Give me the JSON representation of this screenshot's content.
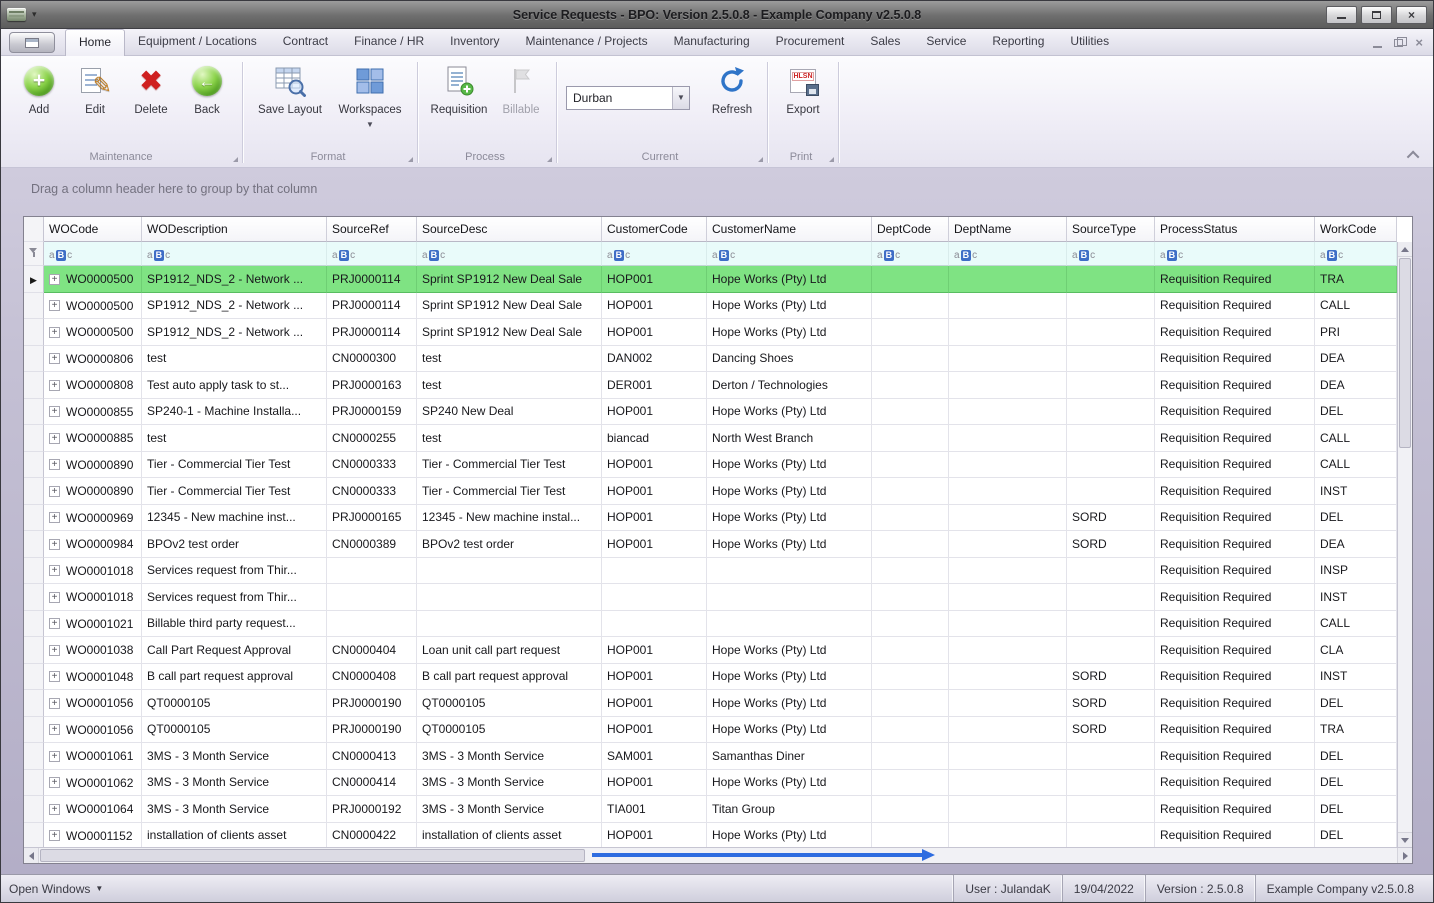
{
  "window": {
    "title": "Service Requests - BPO: Version 2.5.0.8 - Example Company v2.5.0.8"
  },
  "ribbon": {
    "tabs": [
      "Home",
      "Equipment / Locations",
      "Contract",
      "Finance / HR",
      "Inventory",
      "Maintenance / Projects",
      "Manufacturing",
      "Procurement",
      "Sales",
      "Service",
      "Reporting",
      "Utilities"
    ],
    "active_tab": "Home",
    "groups": {
      "maintenance": {
        "label": "Maintenance",
        "add": "Add",
        "edit": "Edit",
        "delete": "Delete",
        "back": "Back"
      },
      "format": {
        "label": "Format",
        "save_layout": "Save Layout",
        "workspaces": "Workspaces"
      },
      "process": {
        "label": "Process",
        "requisition": "Requisition",
        "billable": "Billable"
      },
      "current": {
        "label": "Current",
        "site_value": "Durban",
        "refresh": "Refresh"
      },
      "print": {
        "label": "Print",
        "export": "Export",
        "export_icon_text": "HLSN"
      }
    }
  },
  "grid": {
    "group_hint": "Drag a column header here to group by that column",
    "columns": [
      "WOCode",
      "WODescription",
      "SourceRef",
      "SourceDesc",
      "CustomerCode",
      "CustomerName",
      "DeptCode",
      "DeptName",
      "SourceType",
      "ProcessStatus",
      "WorkCode"
    ],
    "filter_chars": [
      "a",
      "B",
      "c"
    ],
    "selected_row_index": 0,
    "rows": [
      [
        "WO0000500",
        "SP1912_NDS_2 - Network ...",
        "PRJ0000114",
        "Sprint SP1912 New Deal Sale",
        "HOP001",
        "Hope Works (Pty) Ltd",
        "",
        "",
        "",
        "Requisition Required",
        "TRA"
      ],
      [
        "WO0000500",
        "SP1912_NDS_2 - Network ...",
        "PRJ0000114",
        "Sprint SP1912 New Deal Sale",
        "HOP001",
        "Hope Works (Pty) Ltd",
        "",
        "",
        "",
        "Requisition Required",
        "CALL"
      ],
      [
        "WO0000500",
        "SP1912_NDS_2 - Network ...",
        "PRJ0000114",
        "Sprint SP1912 New Deal Sale",
        "HOP001",
        "Hope Works (Pty) Ltd",
        "",
        "",
        "",
        "Requisition Required",
        "PRI"
      ],
      [
        "WO0000806",
        "test",
        "CN0000300",
        "test",
        "DAN002",
        "Dancing Shoes",
        "",
        "",
        "",
        "Requisition Required",
        "DEA"
      ],
      [
        "WO0000808",
        "Test auto apply task to st...",
        "PRJ0000163",
        "test",
        "DER001",
        "Derton / Technologies",
        "",
        "",
        "",
        "Requisition Required",
        "DEA"
      ],
      [
        "WO0000855",
        "SP240-1 - Machine Installa...",
        "PRJ0000159",
        "SP240 New Deal",
        "HOP001",
        "Hope Works (Pty) Ltd",
        "",
        "",
        "",
        "Requisition Required",
        "DEL"
      ],
      [
        "WO0000885",
        "test",
        "CN0000255",
        "test",
        "biancad",
        "North West Branch",
        "",
        "",
        "",
        "Requisition Required",
        "CALL"
      ],
      [
        "WO0000890",
        "Tier - Commercial Tier Test",
        "CN0000333",
        "Tier - Commercial Tier Test",
        "HOP001",
        "Hope Works (Pty) Ltd",
        "",
        "",
        "",
        "Requisition Required",
        "CALL"
      ],
      [
        "WO0000890",
        "Tier - Commercial Tier Test",
        "CN0000333",
        "Tier - Commercial Tier Test",
        "HOP001",
        "Hope Works (Pty) Ltd",
        "",
        "",
        "",
        "Requisition Required",
        "INST"
      ],
      [
        "WO0000969",
        "12345 - New machine inst...",
        "PRJ0000165",
        "12345 - New machine instal...",
        "HOP001",
        "Hope Works (Pty) Ltd",
        "",
        "",
        "SORD",
        "Requisition Required",
        "DEL"
      ],
      [
        "WO0000984",
        "BPOv2 test order",
        "CN0000389",
        "BPOv2 test order",
        "HOP001",
        "Hope Works (Pty) Ltd",
        "",
        "",
        "SORD",
        "Requisition Required",
        "DEA"
      ],
      [
        "WO0001018",
        "Services request from Thir...",
        "",
        "",
        "",
        "",
        "",
        "",
        "",
        "Requisition Required",
        "INSP"
      ],
      [
        "WO0001018",
        "Services request from Thir...",
        "",
        "",
        "",
        "",
        "",
        "",
        "",
        "Requisition Required",
        "INST"
      ],
      [
        "WO0001021",
        "Billable third party request...",
        "",
        "",
        "",
        "",
        "",
        "",
        "",
        "Requisition Required",
        "CALL"
      ],
      [
        "WO0001038",
        "Call Part Request Approval",
        "CN0000404",
        "Loan unit call part request",
        "HOP001",
        "Hope Works (Pty) Ltd",
        "",
        "",
        "",
        "Requisition Required",
        "CLA"
      ],
      [
        "WO0001048",
        "B call part request approval",
        "CN0000408",
        "B call part request approval",
        "HOP001",
        "Hope Works (Pty) Ltd",
        "",
        "",
        "SORD",
        "Requisition Required",
        "INST"
      ],
      [
        "WO0001056",
        "QT0000105",
        "PRJ0000190",
        "QT0000105",
        "HOP001",
        "Hope Works (Pty) Ltd",
        "",
        "",
        "SORD",
        "Requisition Required",
        "DEL"
      ],
      [
        "WO0001056",
        "QT0000105",
        "PRJ0000190",
        "QT0000105",
        "HOP001",
        "Hope Works (Pty) Ltd",
        "",
        "",
        "SORD",
        "Requisition Required",
        "TRA"
      ],
      [
        "WO0001061",
        "3MS - 3 Month Service",
        "CN0000413",
        "3MS - 3 Month Service",
        "SAM001",
        "Samanthas Diner",
        "",
        "",
        "",
        "Requisition Required",
        "DEL"
      ],
      [
        "WO0001062",
        "3MS - 3 Month Service",
        "CN0000414",
        "3MS - 3 Month Service",
        "HOP001",
        "Hope Works (Pty) Ltd",
        "",
        "",
        "",
        "Requisition Required",
        "DEL"
      ],
      [
        "WO0001064",
        "3MS - 3 Month Service",
        "PRJ0000192",
        "3MS - 3 Month Service",
        "TIA001",
        "Titan Group",
        "",
        "",
        "",
        "Requisition Required",
        "DEL"
      ],
      [
        "WO0001152",
        "installation of clients asset",
        "CN0000422",
        "installation of clients asset",
        "HOP001",
        "Hope Works (Pty) Ltd",
        "",
        "",
        "",
        "Requisition Required",
        "DEL"
      ]
    ]
  },
  "statusbar": {
    "open_windows": "Open Windows",
    "user": "User : JulandaK",
    "date": "19/04/2022",
    "version": "Version : 2.5.0.8",
    "company": "Example Company v2.5.0.8"
  },
  "colors": {
    "selection_green": "#7fe383",
    "accent_blue": "#2e6ce0",
    "filter_badge_blue": "#3f6ec6"
  }
}
